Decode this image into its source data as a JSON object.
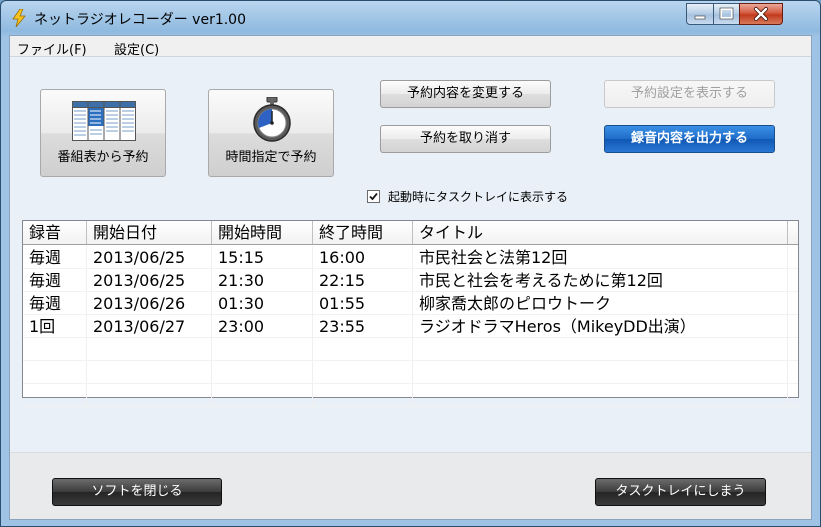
{
  "window": {
    "title": "ネットラジオレコーダー ver1.00"
  },
  "menu": {
    "file": "ファイル(F)",
    "settings": "設定(C)"
  },
  "buttons": {
    "schedule_from_guide": "番組表から予約",
    "schedule_by_time": "時間指定で予約",
    "change_reservation": "予約内容を変更する",
    "cancel_reservation": "予約を取り消す",
    "show_reservation_settings": "予約設定を表示する",
    "export_recordings": "録音内容を出力する",
    "close_software": "ソフトを閉じる",
    "minimize_to_tray": "タスクトレイにしまう"
  },
  "checkbox": {
    "label": "起動時にタスクトレイに表示する",
    "checked": true
  },
  "table": {
    "columns": [
      "録音",
      "開始日付",
      "開始時間",
      "終了時間",
      "タイトル"
    ],
    "rows": [
      [
        "毎週",
        "2013/06/25",
        "15:15",
        "16:00",
        "市民社会と法第12回"
      ],
      [
        "毎週",
        "2013/06/25",
        "21:30",
        "22:15",
        "市民と社会を考えるために第12回"
      ],
      [
        "毎週",
        "2013/06/26",
        "01:30",
        "01:55",
        "柳家喬太郎のピロウトーク"
      ],
      [
        "1回",
        "2013/06/27",
        "23:00",
        "23:55",
        "ラジオドラマHeros（MikeyDD出演）"
      ]
    ]
  },
  "colors": {
    "primary_button": "#1f6cc8",
    "dark_button": "#2f2f2f",
    "title_bar": "#9ec3e4"
  },
  "icons": {
    "app": "lightning-icon",
    "schedule_from_guide": "program-guide-icon",
    "schedule_by_time": "stopwatch-icon"
  }
}
